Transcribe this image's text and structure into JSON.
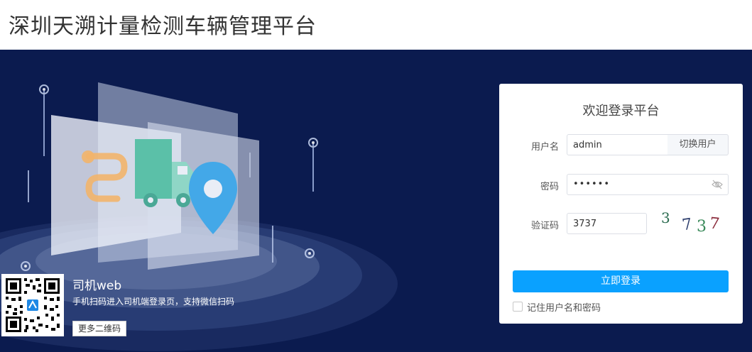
{
  "header": {
    "title": "深圳天溯计量检测车辆管理平台"
  },
  "promo": {
    "title": "司机web",
    "desc": "手机扫码进入司机端登录页，支持微信扫码",
    "more_button": "更多二维码"
  },
  "login": {
    "title": "欢迎登录平台",
    "username_label": "用户名",
    "username_value": "admin",
    "switch_user": "切换用户",
    "password_label": "密码",
    "password_value": "••••••",
    "captcha_label": "验证码",
    "captcha_value": "3737",
    "captcha_image_text": "3737",
    "submit": "立即登录",
    "remember": "记住用户名和密码"
  },
  "colors": {
    "hero_bg": "#0b1b4f",
    "primary": "#0aa1ff"
  }
}
